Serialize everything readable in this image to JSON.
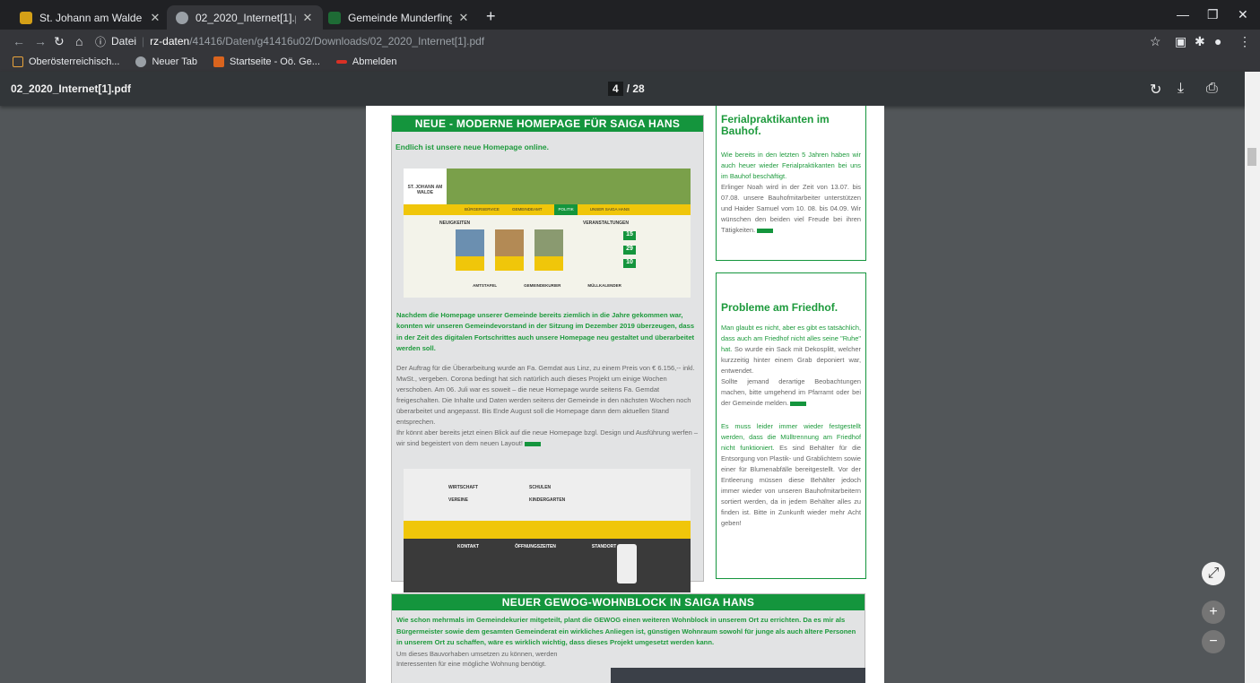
{
  "tabs": [
    {
      "title": "St. Johann am Walde - Home - B",
      "active": false,
      "favicon_color": "#d4a017"
    },
    {
      "title": "02_2020_Internet[1].pdf",
      "active": true,
      "favicon_color": "#9aa0a6"
    },
    {
      "title": "Gemeinde Munderfing",
      "active": false,
      "favicon_color": "#1e6b35"
    }
  ],
  "toolbar": {
    "security_label": "Datei",
    "url_host": "rz-daten",
    "url_path": "/41416/Daten/g41416u02/Downloads/02_2020_Internet[1].pdf"
  },
  "bookmarks": [
    {
      "label": "Oberösterreichisch...",
      "icon": "page-icon"
    },
    {
      "label": "Neuer Tab",
      "icon": "globe-icon"
    },
    {
      "label": "Startseite - Oö. Ge...",
      "icon": "grid-icon"
    },
    {
      "label": "Abmelden",
      "icon": "logout-icon"
    }
  ],
  "pdf": {
    "filename": "02_2020_Internet[1].pdf",
    "current_page": "4",
    "total_pages": "/ 28"
  },
  "article1": {
    "title": "NEUE - MODERNE HOMEPAGE FÜR SAIGA HANS",
    "subtitle": "Endlich ist unsere neue Homepage online.",
    "lead": "Nachdem die Homepage unserer Gemeinde bereits ziemlich in die Jahre gekommen war, konnten wir unseren Gemeindevorstand in der Sitzung im Dezember 2019 überzeugen, dass in der Zeit des digitalen Fortschrittes auch unsere Homepage neu gestaltet und überarbeitet werden soll.",
    "body": "Der Auftrag für die Überarbeitung wurde an Fa. Gemdat aus Linz, zu einem Preis von € 6.156,-- inkl. MwSt., vergeben. Corona bedingt hat sich natürlich auch dieses Projekt um einige Wochen verschoben. Am 06. Juli war es soweit – die neue Homepage wurde seitens Fa. Gemdat freigeschalten. Die Inhalte und Daten werden seitens der Gemeinde in den nächsten Wochen noch überarbeitet und angepasst. Bis Ende August soll die Homepage dann dem aktuellen Stand entsprechen.\nIhr könnt aber bereits jetzt einen Blick auf die neue Homepage bzgl. Design und Ausführung werfen – wir sind begeistert von dem neuen Layout!",
    "shot1": {
      "logo": "ST. JOHANN AM WALDE",
      "menu": [
        "BÜRGERSERVICE",
        "GEMEINDEAMT",
        "POLITIK",
        "UNSER SAIGA HANS"
      ],
      "neuigkeiten": "NEUIGKEITEN",
      "veranstaltungen": "VERANSTALTUNGEN",
      "dates": [
        "15",
        "29",
        "10"
      ],
      "footer": [
        "AMTSTAFEL",
        "GEMEINDEKURIER",
        "MÜLLKALENDER"
      ]
    },
    "shot2": {
      "tiles": [
        "WIRTSCHAFT",
        "SCHULEN",
        "VEREINE",
        "KINDERGARTEN"
      ],
      "footer": [
        "KONTAKT",
        "ÖFFNUNGSZEITEN",
        "STANDORT"
      ]
    }
  },
  "side1": {
    "title": "Ferialpraktikanten im Bauhof.",
    "p1": "Wie bereits in den letzten 5 Jahren haben wir auch heuer wieder Ferialpraktikanten bei uns im Bauhof beschäftigt.",
    "p2": "Erlinger Noah wird in der Zeit von 13.07. bis 07.08. unsere Bauhofmitarbeiter unterstützen und Haider Samuel vom 10. 08. bis 04.09. Wir wünschen den beiden viel Freude bei ihren Tätigkeiten."
  },
  "side2": {
    "title": "Probleme am Friedhof.",
    "p1_green": "Man glaubt es nicht, aber es gibt es tatsächlich, dass auch am Friedhof nicht alles seine \"Ruhe\" hat.",
    "p1": "So wurde ein Sack mit Dekosplitt, welcher kurzzeitig hinter einem Grab deponiert war, entwendet.\nSollte jemand derartige Beobachtungen machen, bitte umgehend im Pfarramt oder bei der Gemeinde melden.",
    "p2_green": "Es muss leider immer wieder festgestellt werden, dass die Mülltrennung am Friedhof nicht funktioniert.",
    "p2": "Es sind Behälter für die Entsorgung von Plastik- und Grablichtern sowie einer für Blumenabfälle bereitgestellt. Vor der Entleerung müssen diese Behälter jedoch immer wieder von unseren Bauhofmitarbeitern sortiert werden, da in jedem Behälter alles zu finden ist. Bitte in Zunkunft wieder mehr Acht geben!"
  },
  "article2": {
    "title": "NEUER GEWOG-WOHNBLOCK IN SAIGA HANS",
    "lead": "Wie schon mehrmals im Gemeindekurier mitgeteilt, plant die GEWOG einen weiteren Wohnblock in unserem Ort zu errichten. Da es mir als Bürgermeister sowie dem gesamten Gemeinderat ein wirkliches Anliegen ist, günstigen Wohnraum sowohl für junge als auch ältere Personen in unserem Ort zu schaffen, wäre es wirklich wichtig, dass dieses Projekt umgesetzt werden kann.",
    "body": "Um dieses Bauvorhaben umsetzen zu können, werden Interessenten für eine mögliche Wohnung benötigt."
  },
  "colors": {
    "accent_green": "#14953d",
    "chrome_dark": "#202124",
    "pdf_bg": "#525659"
  }
}
